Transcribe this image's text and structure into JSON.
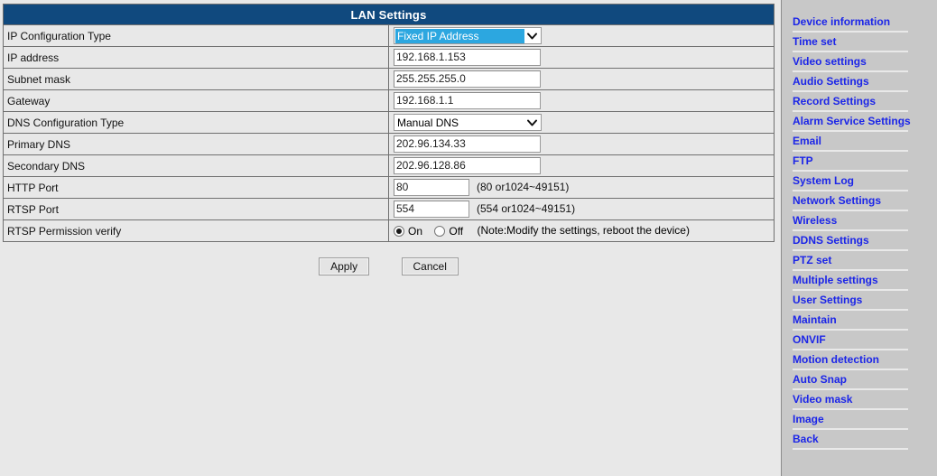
{
  "page": {
    "title": "LAN Settings"
  },
  "form": {
    "rows": [
      {
        "label": "IP Configuration Type",
        "type": "select",
        "value": "Fixed IP Address",
        "highlighted": true
      },
      {
        "label": "IP address",
        "type": "text",
        "value": "192.168.1.153",
        "width": "wide"
      },
      {
        "label": "Subnet mask",
        "type": "text",
        "value": "255.255.255.0",
        "width": "wide"
      },
      {
        "label": "Gateway",
        "type": "text",
        "value": "192.168.1.1",
        "width": "wide"
      },
      {
        "label": "DNS Configuration Type",
        "type": "select",
        "value": "Manual DNS",
        "highlighted": false
      },
      {
        "label": "Primary DNS",
        "type": "text",
        "value": "202.96.134.33",
        "width": "wide"
      },
      {
        "label": "Secondary DNS",
        "type": "text",
        "value": "202.96.128.86",
        "width": "wide"
      },
      {
        "label": "HTTP Port",
        "type": "text",
        "value": "80",
        "width": "narrow",
        "hint": "(80 or1024~49151)"
      },
      {
        "label": "RTSP Port",
        "type": "text",
        "value": "554",
        "width": "narrow",
        "hint": "(554 or1024~49151)"
      },
      {
        "label": "RTSP Permission verify",
        "type": "radio",
        "options": [
          "On",
          "Off"
        ],
        "selected": "On",
        "note": "(Note:Modify the settings, reboot the device)"
      }
    ]
  },
  "labels": {
    "ip_config_type": "IP Configuration Type",
    "ip_address": "IP address",
    "subnet_mask": "Subnet mask",
    "gateway": "Gateway",
    "dns_config_type": "DNS Configuration Type",
    "primary_dns": "Primary DNS",
    "secondary_dns": "Secondary DNS",
    "http_port": "HTTP Port",
    "rtsp_port": "RTSP Port",
    "rtsp_permission": "RTSP Permission verify"
  },
  "values": {
    "ip_config_type": "Fixed IP Address",
    "ip_address": "192.168.1.153",
    "subnet_mask": "255.255.255.0",
    "gateway": "192.168.1.1",
    "dns_config_type": "Manual DNS",
    "primary_dns": "202.96.134.33",
    "secondary_dns": "202.96.128.86",
    "http_port": "80",
    "rtsp_port": "554",
    "rtsp_permission": "On"
  },
  "hints": {
    "http_port": "(80 or1024~49151)",
    "rtsp_port": "(554 or1024~49151)",
    "rtsp_note": "(Note:Modify the settings, reboot the device)"
  },
  "radio": {
    "on": "On",
    "off": "Off"
  },
  "buttons": {
    "apply": "Apply",
    "cancel": "Cancel"
  },
  "sidebar": {
    "items": [
      {
        "label": "Device information"
      },
      {
        "label": "Time set"
      },
      {
        "label": "Video settings"
      },
      {
        "label": "Audio Settings"
      },
      {
        "label": "Record Settings"
      },
      {
        "label": "Alarm Service Settings"
      },
      {
        "label": "Email"
      },
      {
        "label": "FTP"
      },
      {
        "label": "System Log"
      },
      {
        "label": "Network Settings"
      },
      {
        "label": "Wireless"
      },
      {
        "label": "DDNS Settings"
      },
      {
        "label": "PTZ set"
      },
      {
        "label": "Multiple settings"
      },
      {
        "label": "User Settings"
      },
      {
        "label": "Maintain"
      },
      {
        "label": "ONVIF"
      },
      {
        "label": "Motion detection"
      },
      {
        "label": "Auto Snap"
      },
      {
        "label": "Video mask"
      },
      {
        "label": "Image"
      },
      {
        "label": "Back"
      }
    ]
  },
  "colors": {
    "title_bar": "#10497e",
    "link": "#1b25e8",
    "select_highlight": "#2ca7e0",
    "page_bg": "#e8e8e8",
    "sidebar_bg": "#c8c8c8"
  }
}
